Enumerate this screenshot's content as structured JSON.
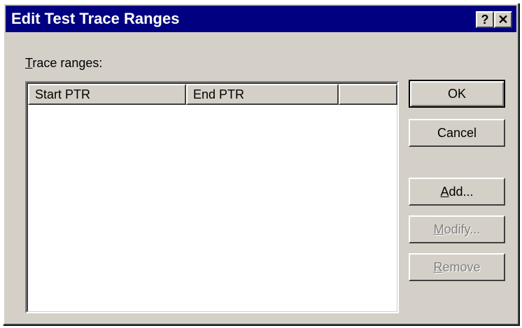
{
  "window": {
    "title": "Edit Test Trace Ranges",
    "help_glyph": "?",
    "close_glyph": "✕"
  },
  "trace_label": {
    "mnemonic": "T",
    "rest": "race ranges:"
  },
  "listview": {
    "columns": [
      "Start PTR",
      "End PTR",
      ""
    ],
    "rows": []
  },
  "buttons": {
    "ok": "OK",
    "cancel": "Cancel",
    "add": {
      "mnemonic": "A",
      "rest": "dd..."
    },
    "modify": {
      "mnemonic": "M",
      "rest": "odify..."
    },
    "remove": {
      "mnemonic": "R",
      "rest": "emove"
    }
  },
  "colors": {
    "title_bar": "#000080",
    "face": "#d4d0c8",
    "disabled_text": "#808080"
  }
}
